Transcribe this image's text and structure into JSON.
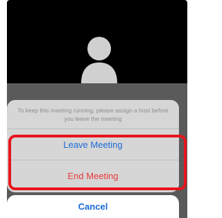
{
  "meeting": {
    "avatar_icon": "user-avatar-icon"
  },
  "action_sheet": {
    "message": "To keep this meeting running, please assign a host before you leave the meeting",
    "leave_label": "Leave Meeting",
    "end_label": "End Meeting",
    "cancel_label": "Cancel"
  },
  "colors": {
    "leave": "#1a6ad6",
    "end": "#e8383a",
    "cancel": "#1a6ad6",
    "highlight": "#e8141b"
  }
}
